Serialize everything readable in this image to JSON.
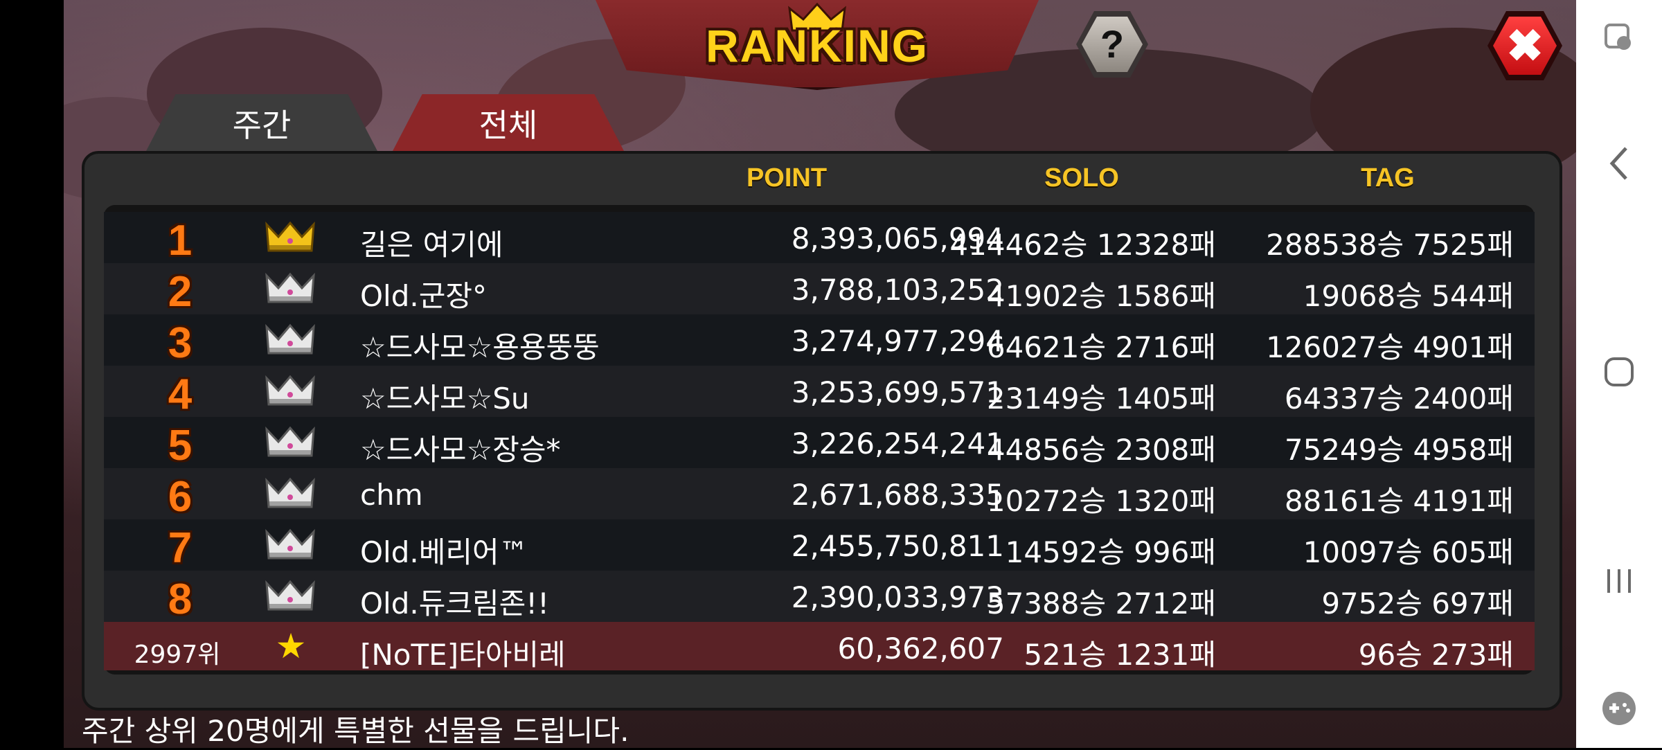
{
  "header": {
    "title": "RANKING",
    "help_label": "?",
    "close_label": "✖"
  },
  "tabs": [
    {
      "label": "주간",
      "selected": true
    },
    {
      "label": "전체",
      "selected": false
    }
  ],
  "columns": {
    "point": "POINT",
    "solo": "SOLO",
    "tag": "TAG"
  },
  "rows": [
    {
      "rank": "1",
      "crown": "gold-crown-icon",
      "name": "길은 여기에",
      "point": "8,393,065,994",
      "solo": "414462승 12328패",
      "tag": "288538승 7525패"
    },
    {
      "rank": "2",
      "crown": "silver-crown-icon",
      "name": "Old.군장°",
      "point": "3,788,103,252",
      "solo": "41902승 1586패",
      "tag": "19068승 544패"
    },
    {
      "rank": "3",
      "crown": "silver-crown-icon",
      "name": "☆드사모☆용용뚱뚱",
      "point": "3,274,977,294",
      "solo": "64621승 2716패",
      "tag": "126027승 4901패"
    },
    {
      "rank": "4",
      "crown": "silver-crown-icon",
      "name": "☆드사모☆Su",
      "point": "3,253,699,571",
      "solo": "23149승 1405패",
      "tag": "64337승 2400패"
    },
    {
      "rank": "5",
      "crown": "silver-crown-icon",
      "name": "☆드사모☆장승*",
      "point": "3,226,254,241",
      "solo": "44856승 2308패",
      "tag": "75249승 4958패"
    },
    {
      "rank": "6",
      "crown": "silver-crown-icon",
      "name": "chm",
      "point": "2,671,688,335",
      "solo": "10272승 1320패",
      "tag": "88161승 4191패"
    },
    {
      "rank": "7",
      "crown": "silver-crown-icon",
      "name": "Old.베리어™",
      "point": "2,455,750,811",
      "solo": "14592승 996패",
      "tag": "10097승 605패"
    },
    {
      "rank": "8",
      "crown": "silver-crown-icon",
      "name": "Old.듀크림존!!",
      "point": "2,390,033,973",
      "solo": "57388승 2712패",
      "tag": "9752승 697패"
    }
  ],
  "my_row": {
    "rank": "2997위",
    "icon": "star-icon",
    "name": "[NoTE]타아비레",
    "point": "60,362,607",
    "solo": "521승 1231패",
    "tag": "96승 273패"
  },
  "footer_text": "주간 상위 20명에게 특별한 선물을 드립니다.",
  "colors": {
    "accent_gold": "#f6c425",
    "rank_orange": "#ff7a14",
    "tab_active": "#3c3c3c",
    "tab_inactive": "#8c2628",
    "close_red": "#e01818",
    "my_row_bg": "#5a2226"
  },
  "system_nav": {
    "icons": [
      "game-tools-icon",
      "back-icon",
      "home-icon",
      "recents-icon",
      "game-launcher-icon"
    ]
  }
}
